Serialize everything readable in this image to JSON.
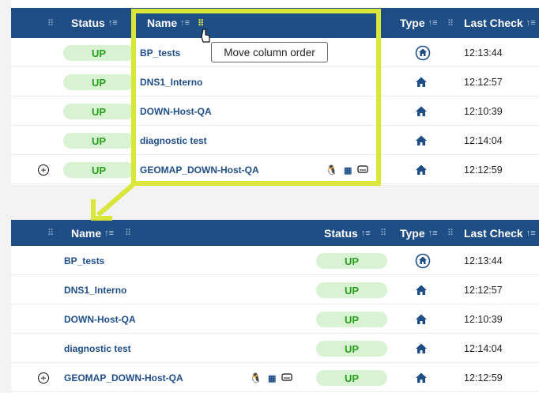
{
  "top_table": {
    "columns": {
      "status": "Status",
      "name": "Name",
      "type": "Type",
      "last_check": "Last Check"
    },
    "rows": [
      {
        "status": "UP",
        "name": "BP_tests",
        "type_icon": "home-circle-icon",
        "last_check": "12:13:44",
        "expandable": false,
        "type_icons": []
      },
      {
        "status": "UP",
        "name": "DNS1_Interno",
        "type_icon": "home-icon",
        "last_check": "12:12:57",
        "expandable": false,
        "type_icons": []
      },
      {
        "status": "UP",
        "name": "DOWN-Host-QA",
        "type_icon": "home-icon",
        "last_check": "12:10:39",
        "expandable": false,
        "type_icons": []
      },
      {
        "status": "UP",
        "name": "diagnostic test",
        "type_icon": "home-icon",
        "last_check": "12:14:04",
        "expandable": false,
        "type_icons": []
      },
      {
        "status": "UP",
        "name": "GEOMAP_DOWN-Host-QA",
        "type_icon": "home-icon",
        "last_check": "12:12:59",
        "expandable": true,
        "type_icons": [
          "linux-icon",
          "grid-icon",
          "hardware-icon"
        ]
      }
    ]
  },
  "tooltip": "Move column order",
  "bottom_table": {
    "columns": {
      "name": "Name",
      "status": "Status",
      "type": "Type",
      "last_check": "Last Check"
    },
    "rows": [
      {
        "status": "UP",
        "name": "BP_tests",
        "type_icon": "home-circle-icon",
        "last_check": "12:13:44",
        "expandable": false
      },
      {
        "status": "UP",
        "name": "DNS1_Interno",
        "type_icon": "home-icon",
        "last_check": "12:12:57",
        "expandable": false
      },
      {
        "status": "UP",
        "name": "DOWN-Host-QA",
        "type_icon": "home-icon",
        "last_check": "12:10:39",
        "expandable": false
      },
      {
        "status": "UP",
        "name": "diagnostic test",
        "type_icon": "home-icon",
        "last_check": "12:14:04",
        "expandable": false
      },
      {
        "status": "UP",
        "name": "GEOMAP_DOWN-Host-QA",
        "type_icon": "home-icon",
        "last_check": "12:12:59",
        "expandable": true
      }
    ]
  },
  "colors": {
    "header": "#1f4e87",
    "status_up_bg": "#d9f2d3",
    "status_up_text": "#26a11b",
    "row_bar": "#30a324",
    "highlight": "#d9e63a"
  }
}
